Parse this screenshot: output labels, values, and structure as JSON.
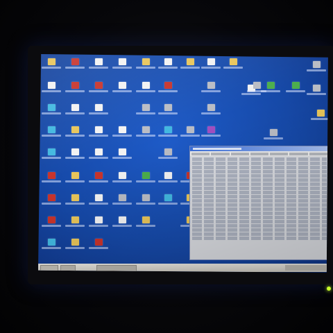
{
  "scene": "photo-of-monitor",
  "colors": {
    "desktop": "#1a52b8",
    "taskbar": "#dcd9d2",
    "led": "#c8ff2a"
  },
  "desktop_icons": [
    {
      "kind": "folder"
    },
    {
      "kind": "red"
    },
    {
      "kind": "doc"
    },
    {
      "kind": "doc"
    },
    {
      "kind": "folder"
    },
    {
      "kind": "doc"
    },
    {
      "kind": "folder"
    },
    {
      "kind": "doc"
    },
    {
      "kind": "folder"
    },
    {
      "kind": "doc"
    },
    {
      "kind": "red"
    },
    {
      "kind": "red"
    },
    {
      "kind": "doc"
    },
    {
      "kind": "doc"
    },
    {
      "kind": "red"
    },
    {
      "kind": "gray"
    },
    {
      "kind": "doc"
    },
    {
      "kind": "gray"
    },
    {
      "kind": "cyan"
    },
    {
      "kind": "doc"
    },
    {
      "kind": "doc"
    },
    {
      "kind": "gray"
    },
    {
      "kind": "gray"
    },
    {
      "kind": "gray"
    },
    {
      "kind": "cyan"
    },
    {
      "kind": "folder"
    },
    {
      "kind": "doc"
    },
    {
      "kind": "doc"
    },
    {
      "kind": "gray"
    },
    {
      "kind": "cyan"
    },
    {
      "kind": "gray"
    },
    {
      "kind": "purple"
    },
    {
      "kind": "gray"
    },
    {
      "kind": "cyan"
    },
    {
      "kind": "doc"
    },
    {
      "kind": "doc"
    },
    {
      "kind": "doc"
    },
    {
      "kind": "gray"
    },
    {
      "kind": "red"
    },
    {
      "kind": "folder"
    },
    {
      "kind": "red"
    },
    {
      "kind": "doc"
    },
    {
      "kind": "green"
    },
    {
      "kind": "doc"
    },
    {
      "kind": "red"
    },
    {
      "kind": "red"
    },
    {
      "kind": "folder"
    },
    {
      "kind": "doc"
    },
    {
      "kind": "gray"
    },
    {
      "kind": "gray"
    },
    {
      "kind": "cyan"
    },
    {
      "kind": "folder"
    },
    {
      "kind": "red"
    },
    {
      "kind": "folder"
    },
    {
      "kind": "doc"
    },
    {
      "kind": "doc"
    },
    {
      "kind": "folder"
    },
    {
      "kind": "folder"
    },
    {
      "kind": "cyan"
    },
    {
      "kind": "folder"
    },
    {
      "kind": "red"
    },
    {
      "kind": "gray"
    },
    {
      "kind": "green"
    },
    {
      "kind": "green"
    },
    {
      "kind": "gray"
    },
    {
      "kind": "folder"
    }
  ],
  "log_window": {
    "row_count": 20,
    "column_count": 7
  }
}
